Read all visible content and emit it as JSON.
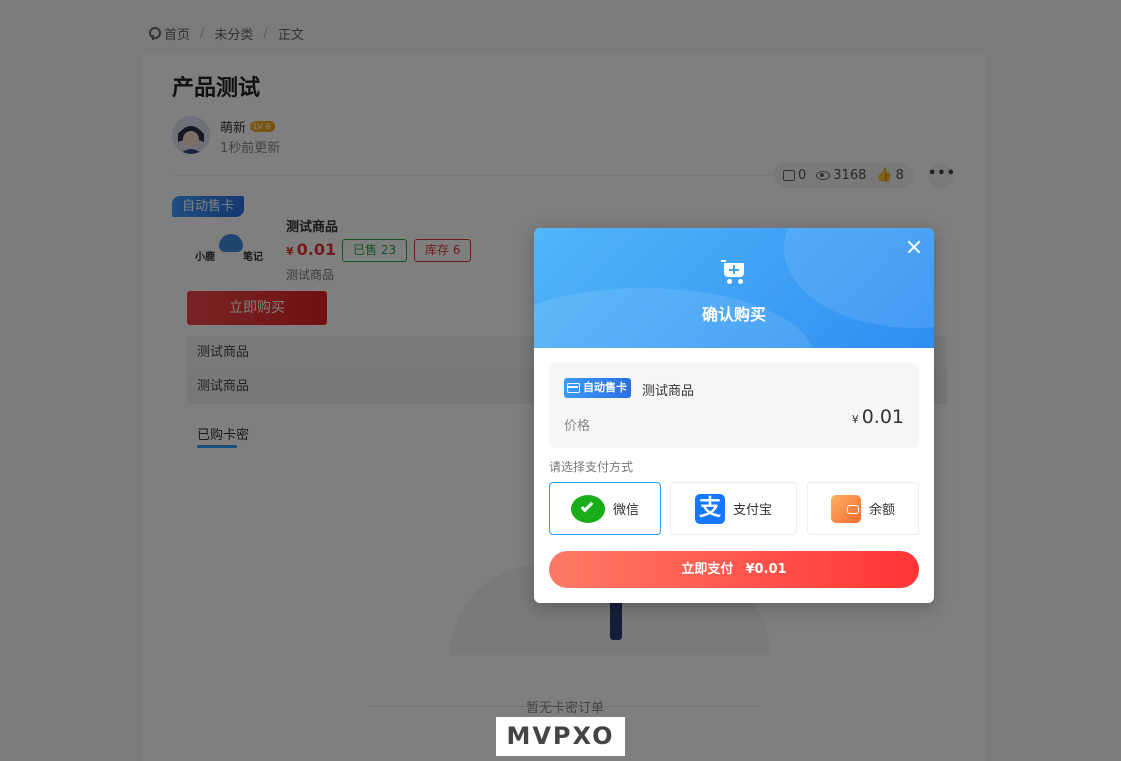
{
  "breadcrumb": {
    "home": "首页",
    "category": "未分类",
    "current": "正文"
  },
  "article": {
    "title": "产品测试",
    "author": "萌新",
    "level": "LV 6",
    "updated": "1秒前更新",
    "stats": {
      "comments": "0",
      "views": "3168",
      "likes": "8"
    }
  },
  "product": {
    "tag": "自动售卡",
    "logo_left": "小鹿",
    "logo_right": "笔记",
    "name": "测试商品",
    "price_symbol": "¥",
    "price": "0.01",
    "sold": "已售 23",
    "stock": "库存 6",
    "desc": "测试商品",
    "buy_label": "立即购买",
    "rows": [
      "测试商品",
      "测试商品"
    ],
    "tab_bought": "已购卡密",
    "empty_text": "暂无卡密订单"
  },
  "watermark": "MVPXO",
  "modal": {
    "title": "确认购买",
    "tag": "自动售卡",
    "item_name": "测试商品",
    "price_label": "价格",
    "price_symbol": "¥",
    "price": "0.01",
    "pay_method_label": "请选择支付方式",
    "methods": [
      {
        "label": "微信",
        "icon": "wechat-icon",
        "selected": true
      },
      {
        "label": "支付宝",
        "icon": "alipay-icon",
        "selected": false
      },
      {
        "label": "余额",
        "icon": "wallet-icon",
        "selected": false
      }
    ],
    "pay_button": "立即支付",
    "pay_amount": "¥0.01",
    "alipay_glyph": "支"
  },
  "colors": {
    "accent": "#2a9df4",
    "danger": "#e53935",
    "wechat": "#1aad19",
    "alipay": "#1677ff"
  }
}
